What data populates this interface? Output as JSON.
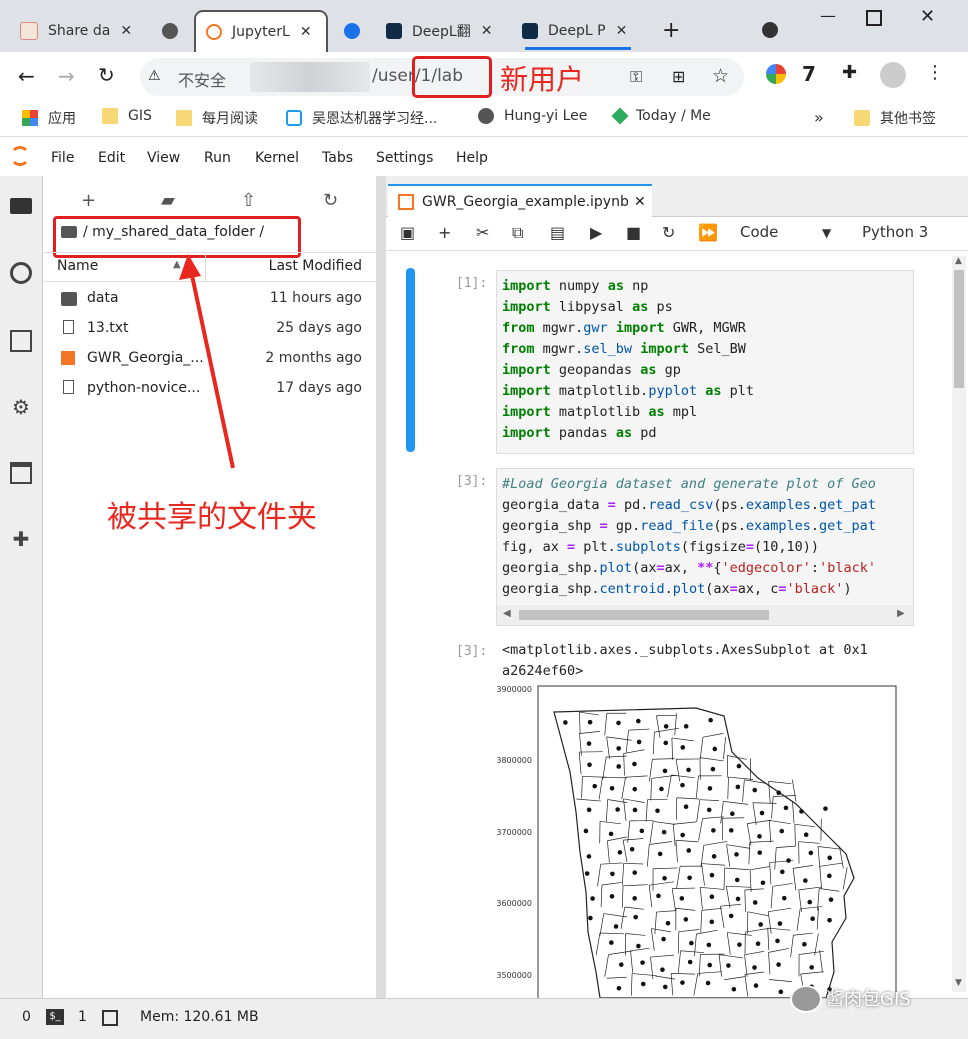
{
  "browser": {
    "tabs": [
      {
        "label": "Share da"
      },
      {
        "label": ""
      },
      {
        "label": "JupyterL"
      },
      {
        "label": ""
      },
      {
        "label": "DeepL翻"
      },
      {
        "label": "DeepL P"
      }
    ],
    "address": {
      "security": "不安全",
      "url": "/user/1/lab"
    },
    "bookmarks": [
      "应用",
      "GIS",
      "每月阅读",
      "吴恩达机器学习经...",
      "Hung-yi Lee",
      "Today / Me",
      "其他书签"
    ]
  },
  "annotations": {
    "new_user": "新用户",
    "shared_folder": "被共享的文件夹"
  },
  "jupyter": {
    "menu": [
      "File",
      "Edit",
      "View",
      "Run",
      "Kernel",
      "Tabs",
      "Settings",
      "Help"
    ],
    "breadcrumb": "/ my_shared_data_folder /",
    "columns": {
      "name": "Name",
      "modified": "Last Modified"
    },
    "files": [
      {
        "name": "data",
        "modified": "11 hours ago"
      },
      {
        "name": "13.txt",
        "modified": "25 days ago"
      },
      {
        "name": "GWR_Georgia_...",
        "modified": "2 months ago"
      },
      {
        "name": "python-novice...",
        "modified": "17 days ago"
      }
    ],
    "notebook_tab": "GWR_Georgia_example.ipynb",
    "cell_type": "Code",
    "kernel": "Python 3",
    "prompts": [
      "[1]:",
      "[3]:",
      "[3]:"
    ],
    "output_text_1": "<matplotlib.axes._subplots.AxesSubplot at 0x1",
    "output_text_2": "a2624ef60>",
    "y_ticks": [
      "3900000",
      "3800000",
      "3700000",
      "3600000",
      "3500000"
    ]
  },
  "status": {
    "zero": "0",
    "one": "1",
    "mem": "Mem: 120.61 MB"
  },
  "watermark": "酱肉包GIS"
}
